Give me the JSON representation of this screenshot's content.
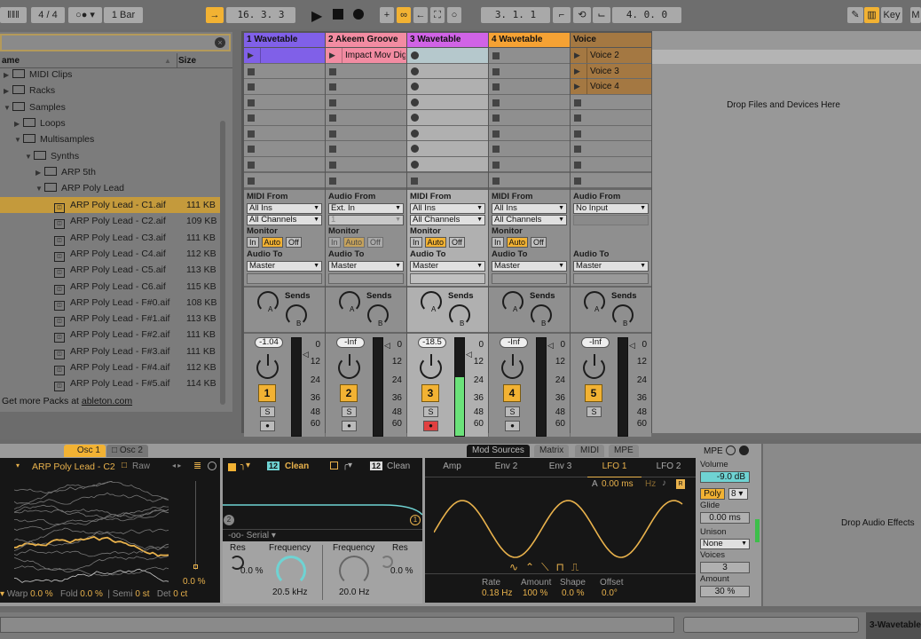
{
  "transport": {
    "time_sig": "4 / 4",
    "quantize": "1 Bar",
    "position": "16. 3. 3",
    "loop_start": "3. 1. 1",
    "loop_length": "4. 0. 0",
    "key_label": "Key",
    "m_label": "M"
  },
  "browser": {
    "col_name": "ame",
    "col_size": "Size",
    "folders": [
      {
        "label": "MIDI Clips",
        "depth": 0,
        "open": false
      },
      {
        "label": "Racks",
        "depth": 0,
        "open": false
      },
      {
        "label": "Samples",
        "depth": 0,
        "open": true
      },
      {
        "label": "Loops",
        "depth": 1,
        "open": false
      },
      {
        "label": "Multisamples",
        "depth": 1,
        "open": true
      },
      {
        "label": "Synths",
        "depth": 2,
        "open": true
      },
      {
        "label": "ARP 5th",
        "depth": 3,
        "open": false
      },
      {
        "label": "ARP Poly Lead",
        "depth": 3,
        "open": true
      }
    ],
    "files": [
      {
        "name": "ARP Poly Lead - C1.aif",
        "size": "111 KB",
        "selected": true
      },
      {
        "name": "ARP Poly Lead - C2.aif",
        "size": "109 KB"
      },
      {
        "name": "ARP Poly Lead - C3.aif",
        "size": "111 KB"
      },
      {
        "name": "ARP Poly Lead - C4.aif",
        "size": "112 KB"
      },
      {
        "name": "ARP Poly Lead - C5.aif",
        "size": "113 KB"
      },
      {
        "name": "ARP Poly Lead - C6.aif",
        "size": "115 KB"
      },
      {
        "name": "ARP Poly Lead - F#0.aif",
        "size": "108 KB"
      },
      {
        "name": "ARP Poly Lead - F#1.aif",
        "size": "113 KB"
      },
      {
        "name": "ARP Poly Lead - F#2.aif",
        "size": "111 KB"
      },
      {
        "name": "ARP Poly Lead - F#3.aif",
        "size": "111 KB"
      },
      {
        "name": "ARP Poly Lead - F#4.aif",
        "size": "112 KB"
      },
      {
        "name": "ARP Poly Lead - F#5.aif",
        "size": "114 KB"
      }
    ],
    "more_packs_prefix": "Get more Packs at ",
    "more_packs_link": "ableton.com"
  },
  "tracks": [
    {
      "name": "1 Wavetable",
      "color": "#8060e8",
      "clip_color": "#8060e8",
      "clips": [
        ""
      ],
      "slot": "stop",
      "io": "MIDI From",
      "from": "All Ins",
      "channel": "All Channels",
      "monitor": "Auto",
      "to": "Master",
      "volume": "-1.04",
      "number": "1",
      "arm": false,
      "level": 0
    },
    {
      "name": "2 Akeem Groove",
      "color": "#f28ca2",
      "clip_color": "#f28ca2",
      "clips": [
        "Impact Mov Dig"
      ],
      "slot": "stop",
      "io": "Audio From",
      "from": "Ext. In",
      "channel": "1",
      "monitor": "Auto",
      "monitor_disabled": true,
      "to": "Master",
      "volume": "-Inf",
      "number": "2",
      "arm": false,
      "level": 0
    },
    {
      "name": "3 Wavetable",
      "color": "#d063e6",
      "clip_color": "",
      "clips": [],
      "slot": "rec",
      "io": "MIDI From",
      "from": "All Ins",
      "channel": "All Channels",
      "monitor": "Auto",
      "to": "Master",
      "volume": "-18.5",
      "number": "3",
      "arm": true,
      "level": 0.6
    },
    {
      "name": "4 Wavetable",
      "color": "#f5a234",
      "clip_color": "",
      "clips": [],
      "slot": "stop",
      "io": "MIDI From",
      "from": "All Ins",
      "channel": "All Channels",
      "monitor": "Auto",
      "to": "Master",
      "volume": "-Inf",
      "number": "4",
      "arm": false,
      "level": 0
    },
    {
      "name": "Voice",
      "color": "#a47842",
      "clip_color": "#a47842",
      "clips": [
        "Voice 2",
        "Voice 3",
        "Voice 4"
      ],
      "slot": "stop",
      "io": "Audio From",
      "from": "No Input",
      "channel": "",
      "monitor": "",
      "to": "Master",
      "volume": "-Inf",
      "number": "5",
      "arm": false,
      "level": 0
    }
  ],
  "mixer": {
    "sends": "Sends",
    "send_a": "A",
    "send_b": "B",
    "solo": "S",
    "scale": [
      "0",
      "12",
      "24",
      "36",
      "48",
      "60"
    ],
    "monitor_in": "In",
    "monitor_auto": "Auto",
    "monitor_off": "Off",
    "monitor_label": "Monitor",
    "audio_to": "Audio To"
  },
  "drop_files": "Drop Files and Devices Here",
  "drop_effects": "Drop Audio Effects",
  "device": {
    "tabs": [
      "Osc 1",
      "Osc 2"
    ],
    "wavetable": "ARP Poly Lead - C2",
    "raw": "Raw",
    "position": "0.0 %",
    "warp_label": "Warp",
    "warp": "0.0 %",
    "fold_label": "Fold",
    "fold": "0.0 %",
    "semi_label": "Semi",
    "semi": "0 st",
    "det_label": "Det",
    "det": "0 ct",
    "filter": {
      "slope1": "12",
      "type1": "Clean",
      "slope2": "12",
      "type2": "Clean",
      "routing": "Serial",
      "res_label": "Res",
      "res1": "0.0 %",
      "freq_label": "Frequency",
      "freq1": "20.5 kHz",
      "freq2": "20.0 Hz",
      "res2": "0.0 %",
      "badge1": "1",
      "badge2": "2"
    },
    "mod_tabs": [
      "Mod Sources",
      "Matrix",
      "MIDI",
      "MPE"
    ],
    "mod_sources": [
      "Amp",
      "Env 2",
      "Env 3",
      "LFO 1",
      "LFO 2"
    ],
    "active_source": "LFO 1",
    "lfo": {
      "attack_label": "A",
      "attack": "0.00 ms",
      "unit": "Hz",
      "rate_label": "Rate",
      "rate": "0.18 Hz",
      "amount_label": "Amount",
      "amount": "100 %",
      "shape_label": "Shape",
      "shape": "0.0 %",
      "offset_label": "Offset",
      "offset": "0.0°",
      "r": "R"
    },
    "global": {
      "mpe": "MPE",
      "volume_label": "Volume",
      "volume": "-9.0 dB",
      "poly": "Poly",
      "voices_count": "8",
      "glide_label": "Glide",
      "glide": "0.00 ms",
      "unison_label": "Unison",
      "unison": "None",
      "voices_label": "Voices",
      "voices": "3",
      "amount_label": "Amount",
      "amount": "30 %"
    }
  },
  "status": {
    "track": "3-Wavetable"
  },
  "colors": {
    "accent": "#f2b233",
    "lfo": "#e9b24c",
    "filter": "#6fd3d3"
  }
}
